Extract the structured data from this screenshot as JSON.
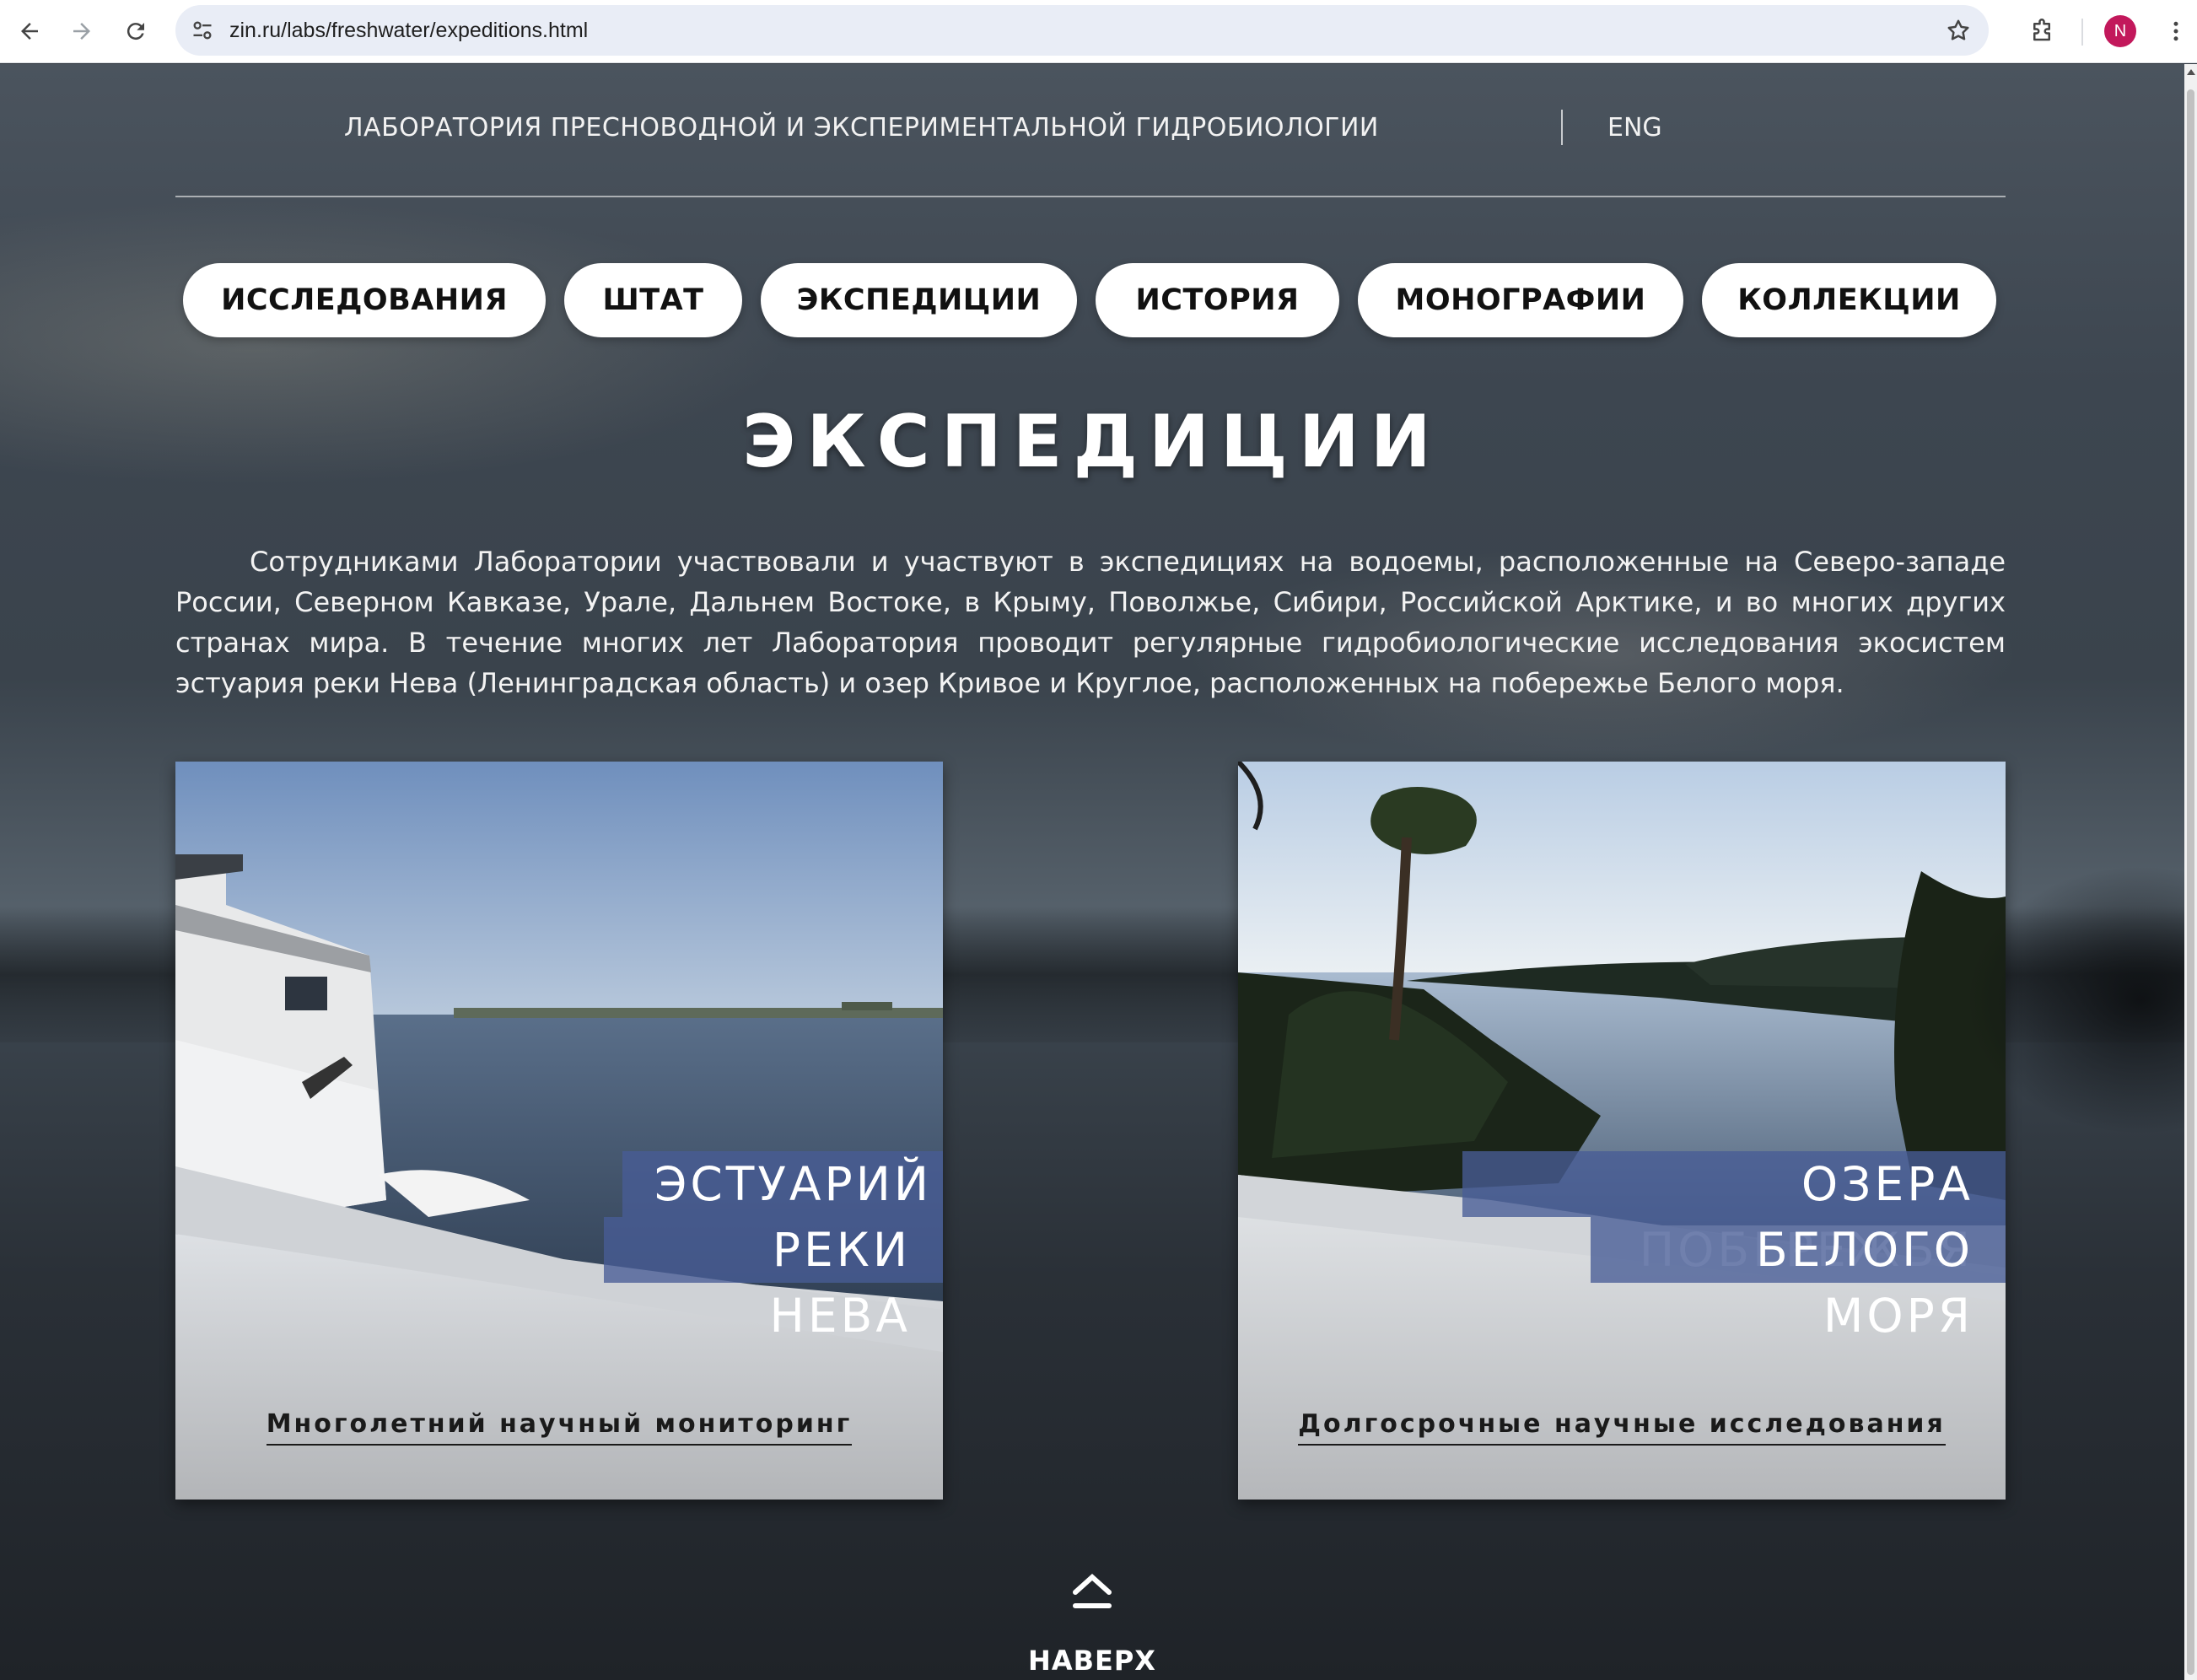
{
  "browser": {
    "url": "zin.ru/labs/freshwater/expeditions.html",
    "profile_initial": "N",
    "icons": [
      "back-arrow-icon",
      "forward-arrow-icon",
      "reload-icon",
      "site-info-icon",
      "bookmark-star-icon",
      "extensions-icon",
      "menu-dots-icon"
    ]
  },
  "header": {
    "lab_title": "ЛАБОРАТОРИЯ ПРЕСНОВОДНОЙ И ЭКСПЕРИМЕНТАЛЬНОЙ ГИДРОБИОЛОГИИ",
    "lang_switch": "ENG"
  },
  "nav": {
    "items": [
      {
        "label": "ИССЛЕДОВАНИЯ"
      },
      {
        "label": "ШТАТ"
      },
      {
        "label": "ЭКСПЕДИЦИИ"
      },
      {
        "label": "ИСТОРИЯ"
      },
      {
        "label": "МОНОГРАФИИ"
      },
      {
        "label": "КОЛЛЕКЦИИ"
      }
    ]
  },
  "main": {
    "heading": "ЭКСПЕДИЦИИ",
    "intro": "Сотрудниками Лаборатории участвовали и участвуют в экспедициях на водоемы, расположенные на Северо-западе России, Северном Кавказе, Урале, Дальнем Востоке, в Крыму, Поволжье, Сибири, Российской Арктике, и во многих других странах мира. В течение многих лет Лаборатория проводит регулярные гидробиологические исследования экосистем эстуария реки Нева (Ленинградская область) и озер Кривое и Круглое, расположенных на побережье Белого моря.",
    "cards": [
      {
        "title_line1": "ЭСТУАРИЙ",
        "title_line2": "РЕКИ НЕВА",
        "link": "Многолетний научный мониторинг"
      },
      {
        "title_line1": "ОЗЕРА ПОБЕРЕЖЬЯ",
        "title_line2": "БЕЛОГО МОРЯ",
        "link": "Долгосрочные научные исследования"
      }
    ],
    "to_top": "НАВЕРХ"
  },
  "colors": {
    "card_title_bg": "#485c96",
    "avatar": "#c2185b"
  }
}
